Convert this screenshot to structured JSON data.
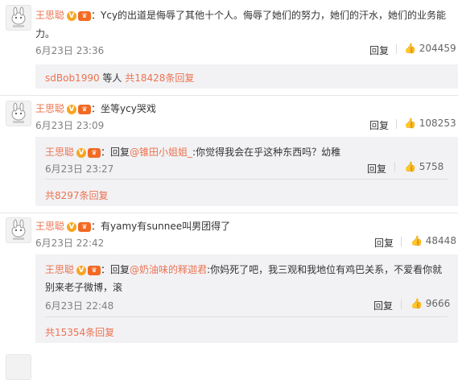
{
  "comments": [
    {
      "username": "王思聪",
      "text_line1": "：Ycy的出道是侮辱了其他十个人。侮辱了她们的努力，她们的汗水，她们的业务能",
      "text_line2": "力。",
      "time": "6月23日 23:36",
      "reply_label": "回复",
      "likes": "204459",
      "sub_prefix_user": "sdBob1990",
      "sub_middle": " 等人 ",
      "sub_count_link": "共18428条回复"
    },
    {
      "username": "王思聪",
      "text": "：坐等ycy哭戏",
      "time": "6月23日 23:09",
      "reply_label": "回复",
      "likes": "108253",
      "reply": {
        "username": "王思聪",
        "prefix": "：回复",
        "mention": "@锥田小姐姐_",
        "text": ":你觉得我会在乎这种东西吗？幼稚",
        "time": "6月23日 23:27",
        "reply_label": "回复",
        "likes": "5758"
      },
      "more_link": "共8297条回复"
    },
    {
      "username": "王思聪",
      "text": "：有yamy有sunnee叫男团得了",
      "time": "6月23日 22:42",
      "reply_label": "回复",
      "likes": "48448",
      "reply": {
        "username": "王思聪",
        "prefix": "：回复",
        "mention": "@奶油味的释迦君",
        "text_line1": ":你妈死了吧，我三观和我地位有鸡巴关系，不爱看你就",
        "text_line2": "别来老子微博，滚",
        "time": "6月23日 22:48",
        "reply_label": "回复",
        "likes": "9666"
      },
      "more_link": "共15354条回复"
    }
  ],
  "icons": {
    "verified": "V",
    "vip": "vip-crown-badge",
    "like": "thumbs-up-icon"
  },
  "colors": {
    "username": "#eb7350",
    "sub_bg": "#f2f2f5"
  }
}
